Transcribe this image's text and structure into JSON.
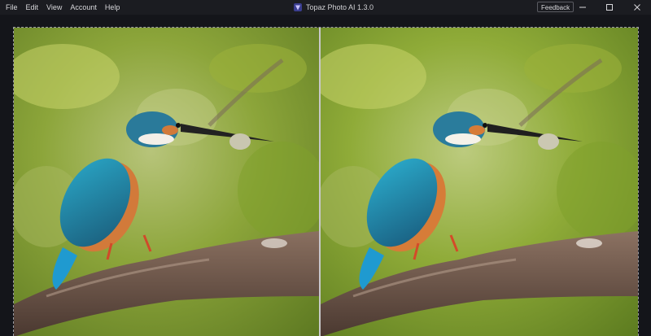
{
  "menu": [
    "File",
    "Edit",
    "View",
    "Account",
    "Help"
  ],
  "app": {
    "title": "Topaz Photo AI 1.3.0"
  },
  "toolbar": {
    "feedback_label": "Feedback"
  },
  "icons": {
    "logo": "topaz-logo-icon",
    "minimize": "minimize-icon",
    "maximize": "maximize-icon",
    "close": "close-icon"
  },
  "colors": {
    "accent": "#7b5cff",
    "background": "#16171c"
  }
}
